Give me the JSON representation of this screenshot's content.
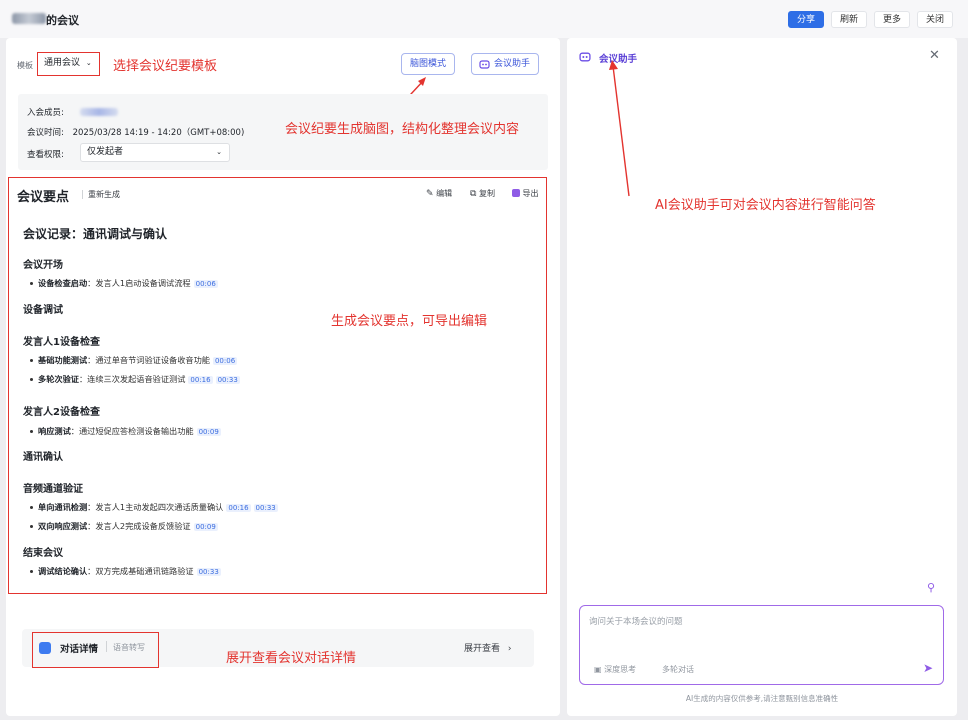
{
  "topbar": {
    "title": "的会议",
    "buttons": {
      "share": "分享",
      "refresh": "刷新",
      "more": "更多",
      "close": "关闭"
    }
  },
  "template": {
    "label": "模板",
    "value": "通用会议",
    "annotation": "选择会议纪要模板"
  },
  "header_buttons": {
    "mindmap": "脑图模式",
    "assistant": "会议助手"
  },
  "annotations": {
    "mindmap": "会议纪要生成脑图，结构化整理会议内容",
    "summary": "生成会议要点，可导出编辑",
    "conversation": "展开查看会议对话详情",
    "assistant": "AI会议助手可对会议内容进行智能问答"
  },
  "info": {
    "members_label": "入会成员:",
    "time_label": "会议时间:",
    "time_value": "2025/03/28 14:19 - 14:20（GMT+08:00)",
    "permission_label": "查看权限:",
    "permission_value": "仅发起者"
  },
  "summary": {
    "title": "会议要点",
    "regenerate": "重新生成",
    "tools": {
      "edit": "编辑",
      "copy": "复制",
      "export": "导出"
    },
    "heading": "会议记录：通讯调试与确认",
    "sections": {
      "s1": "会议开场",
      "s1_item_label": "设备检查启动",
      "s1_item_text": "：发言人1启动设备调试流程",
      "s1_item_ts": "00:06",
      "s2": "设备调试",
      "s3": "发言人1设备检查",
      "s3_item1_label": "基础功能测试",
      "s3_item1_text": "：通过单音节词验证设备收音功能",
      "s3_item1_ts": "00:06",
      "s3_item2_label": "多轮次验证",
      "s3_item2_text": "：连续三次发起语音验证测试",
      "s3_item2_ts1": "00:16",
      "s3_item2_ts2": "00:33",
      "s4": "发言人2设备检查",
      "s4_item_label": "响应测试",
      "s4_item_text": "：通过短促应答检测设备输出功能",
      "s4_item_ts": "00:09",
      "s5": "通讯确认",
      "s6": "音频通道验证",
      "s6_item1_label": "单向通讯检测",
      "s6_item1_text": "：发言人1主动发起四次通话质量确认",
      "s6_item1_ts1": "00:16",
      "s6_item1_ts2": "00:33",
      "s6_item2_label": "双向响应测试",
      "s6_item2_text": "：发言人2完成设备反馈验证",
      "s6_item2_ts": "00:09",
      "s7": "结束会议",
      "s7_item_label": "调试结论确认",
      "s7_item_text": "：双方完成基础通讯链路验证",
      "s7_item_ts": "00:33"
    }
  },
  "conversation": {
    "title": "对话详情",
    "tag": "语音转写",
    "expand": "展开查看"
  },
  "assistant": {
    "title": "会议助手",
    "placeholder": "询问关于本场会议的问题",
    "deep_think": "深度思考",
    "multi_turn": "多轮对话",
    "footnote": "AI生成的内容仅供参考,请注意甄别信息准确性"
  }
}
